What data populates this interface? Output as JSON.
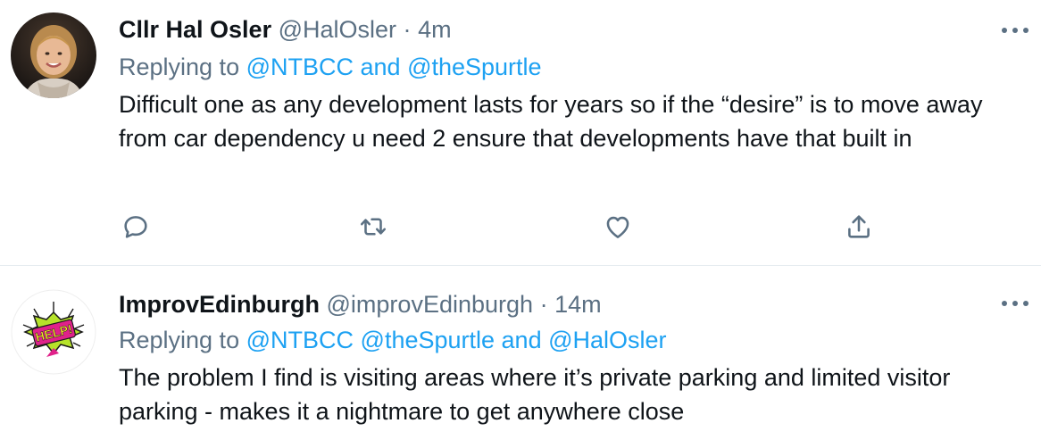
{
  "tweets": [
    {
      "name": "Cllr Hal Osler",
      "handle": "@HalOsler",
      "separator": "·",
      "time": "4m",
      "replying_prefix": "Replying to",
      "mentions": [
        "@NTBCC",
        "@theSpurtle"
      ],
      "joiners": [
        " and "
      ],
      "text": "Difficult one as any development lasts for years so if the “desire” is to move away from car dependency u need 2 ensure that developments have that built in",
      "actions": [
        "reply-icon",
        "retweet-icon",
        "like-icon",
        "share-icon"
      ]
    },
    {
      "name": "ImprovEdinburgh",
      "handle": "@improvEdinburgh",
      "separator": "·",
      "time": "14m",
      "replying_prefix": "Replying to",
      "mentions": [
        "@NTBCC",
        "@theSpurtle",
        "@HalOsler"
      ],
      "joiners": [
        " ",
        " and "
      ],
      "text": "The problem I find is visiting areas where it’s private parking and limited visitor parking - makes it a nightmare to get anywhere close",
      "avatar_logo_text": "HELP!"
    }
  ],
  "colors": {
    "mention": "#1da1f2",
    "muted": "#5b7083",
    "text": "#0f1419",
    "divider": "#e6ecf0",
    "avatar2_burst": "#b6e32a",
    "avatar2_logo": "#e0218a"
  }
}
